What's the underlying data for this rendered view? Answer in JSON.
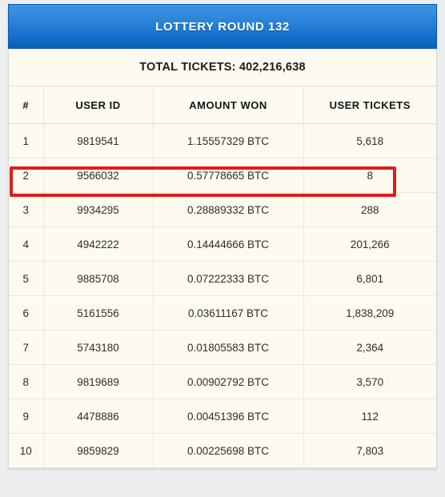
{
  "panel": {
    "title": "LOTTERY ROUND 132",
    "total_tickets_label": "TOTAL TICKETS: 402,216,638",
    "accent_color": "#1670cb",
    "background_color": "#fdfbef",
    "page_background_color": "#eceef0",
    "highlight_color": "#e01b1b"
  },
  "table": {
    "columns": [
      "#",
      "USER ID",
      "AMOUNT WON",
      "USER TICKETS"
    ],
    "rows": [
      {
        "rank": "1",
        "user_id": "9819541",
        "amount_won": "1.15557329 BTC",
        "user_tickets": "5,618"
      },
      {
        "rank": "2",
        "user_id": "9566032",
        "amount_won": "0.57778665 BTC",
        "user_tickets": "8"
      },
      {
        "rank": "3",
        "user_id": "9934295",
        "amount_won": "0.28889332 BTC",
        "user_tickets": "288"
      },
      {
        "rank": "4",
        "user_id": "4942222",
        "amount_won": "0.14444666 BTC",
        "user_tickets": "201,266"
      },
      {
        "rank": "5",
        "user_id": "9885708",
        "amount_won": "0.07222333 BTC",
        "user_tickets": "6,801"
      },
      {
        "rank": "6",
        "user_id": "5161556",
        "amount_won": "0.03611167 BTC",
        "user_tickets": "1,838,209"
      },
      {
        "rank": "7",
        "user_id": "5743180",
        "amount_won": "0.01805583 BTC",
        "user_tickets": "2,364"
      },
      {
        "rank": "8",
        "user_id": "9819689",
        "amount_won": "0.00902792 BTC",
        "user_tickets": "3,570"
      },
      {
        "rank": "9",
        "user_id": "4478886",
        "amount_won": "0.00451396 BTC",
        "user_tickets": "112"
      },
      {
        "rank": "10",
        "user_id": "9859829",
        "amount_won": "0.00225698 BTC",
        "user_tickets": "7,803"
      }
    ],
    "highlighted_row_index": 1
  }
}
